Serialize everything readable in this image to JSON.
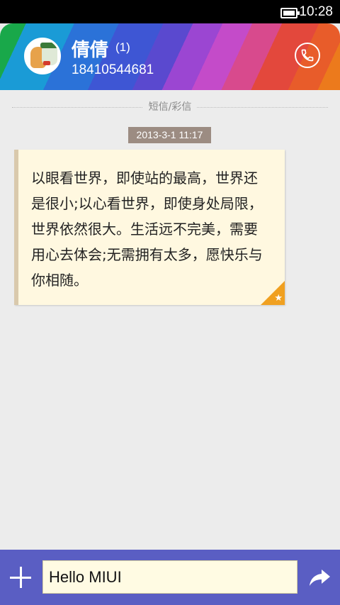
{
  "status_bar": {
    "time": "10:28"
  },
  "header": {
    "contact_name": "倩倩",
    "message_count": "(1)",
    "phone_number": "18410544681",
    "call_icon": "phone-icon"
  },
  "thread": {
    "divider_label": "短信/彩信",
    "timestamp": "2013-3-1 11:17",
    "message_text": "以眼看世界，即使站的最高，世界还是很小;以心看世界，即使身处局限，世界依然很大。生活远不完美，需要用心去体会;无需拥有太多，愿快乐与你相随。",
    "star_icon": "star-icon"
  },
  "composer": {
    "input_value": "Hello MIUI",
    "add_icon": "plus-icon",
    "send_icon": "send-arrow-icon"
  },
  "colors": {
    "bottom_bar": "#5a5ec3",
    "bubble": "#fff8e0",
    "timestamp_bg": "#9c8c82"
  }
}
